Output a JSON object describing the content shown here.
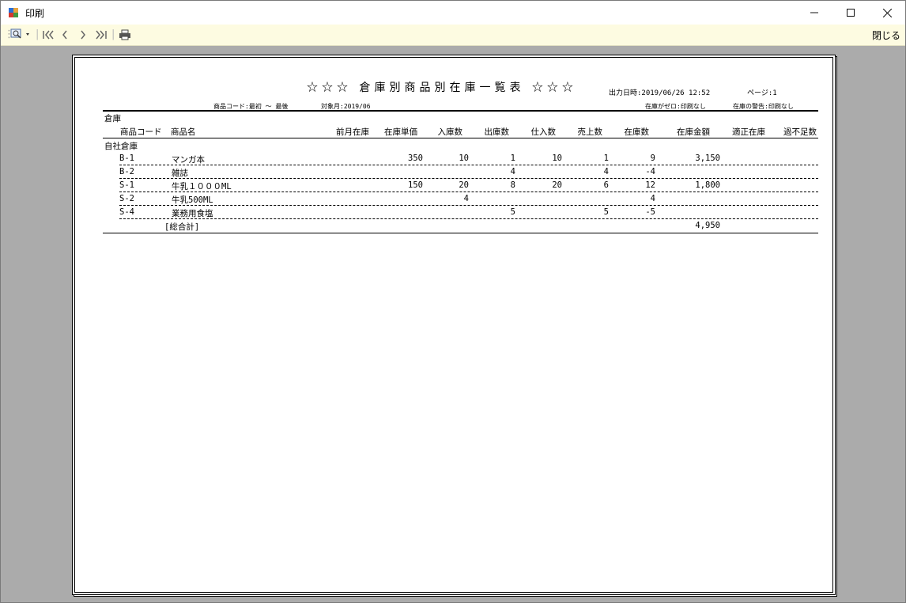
{
  "window": {
    "title": "印刷"
  },
  "toolbar": {
    "close_label": "閉じる"
  },
  "report": {
    "title": "☆☆☆ 倉庫別商品別在庫一覧表 ☆☆☆",
    "output_datetime": "出力日時:2019/06/26 12:52",
    "page": "ページ:1",
    "product_code_range": "商品コード:最初 〜 最後",
    "target_month": "対象月:2019/06",
    "zero_stock": "在庫がゼロ:印刷なし",
    "stock_warning": "在庫の警告:印刷なし",
    "group_header": "倉庫",
    "columns": [
      "商品コード",
      "商品名",
      "前月在庫",
      "在庫単価",
      "入庫数",
      "出庫数",
      "仕入数",
      "売上数",
      "在庫数",
      "在庫金額",
      "適正在庫",
      "過不足数"
    ],
    "warehouse": "自社倉庫",
    "rows": [
      {
        "code": "B-1",
        "name": "マンガ本",
        "prev_stock": "",
        "unit_price": "350",
        "in_qty": "10",
        "out_qty": "1",
        "purchase_qty": "10",
        "sales_qty": "1",
        "stock_qty": "9",
        "stock_amount": "3,150",
        "proper_stock": "",
        "excess": ""
      },
      {
        "code": "B-2",
        "name": "雑誌",
        "prev_stock": "",
        "unit_price": "",
        "in_qty": "",
        "out_qty": "4",
        "purchase_qty": "",
        "sales_qty": "4",
        "stock_qty": "-4",
        "stock_amount": "",
        "proper_stock": "",
        "excess": ""
      },
      {
        "code": "S-1",
        "name": "牛乳１０００ML",
        "prev_stock": "",
        "unit_price": "150",
        "in_qty": "20",
        "out_qty": "8",
        "purchase_qty": "20",
        "sales_qty": "6",
        "stock_qty": "12",
        "stock_amount": "1,800",
        "proper_stock": "",
        "excess": ""
      },
      {
        "code": "S-2",
        "name": "牛乳500ML",
        "prev_stock": "",
        "unit_price": "",
        "in_qty": "4",
        "out_qty": "",
        "purchase_qty": "",
        "sales_qty": "",
        "stock_qty": "4",
        "stock_amount": "",
        "proper_stock": "",
        "excess": ""
      },
      {
        "code": "S-4",
        "name": "業務用食塩",
        "prev_stock": "",
        "unit_price": "",
        "in_qty": "",
        "out_qty": "5",
        "purchase_qty": "",
        "sales_qty": "5",
        "stock_qty": "-5",
        "stock_amount": "",
        "proper_stock": "",
        "excess": ""
      }
    ],
    "total_label": "[総合計]",
    "total_amount": "4,950"
  }
}
